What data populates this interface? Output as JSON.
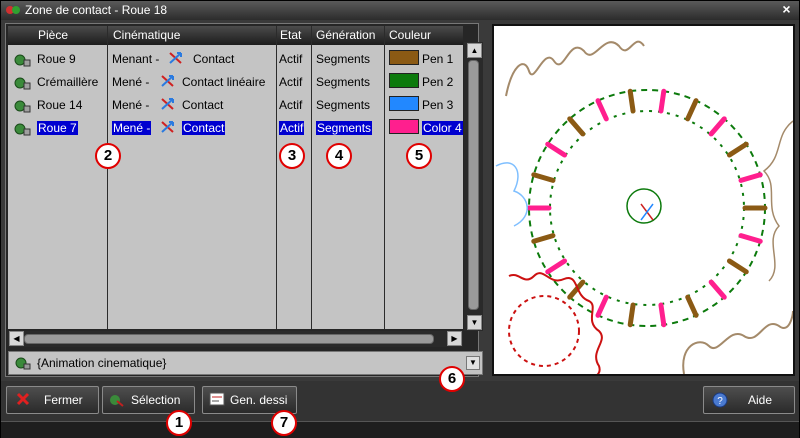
{
  "window": {
    "title": "Zone de contact - Roue 18",
    "close_glyph": "×"
  },
  "grid": {
    "headers": {
      "piece": "Pièce",
      "cinematique": "Cinématique",
      "etat": "Etat",
      "generation": "Génération",
      "couleur": "Couleur"
    },
    "rows": [
      {
        "piece": "Roue 9",
        "cin_prefix": "Menant -",
        "cin_type": "Contact",
        "etat": "Actif",
        "generation": "Segments",
        "swatch": "#8b5a14",
        "color_name": "Pen 1",
        "selected": false
      },
      {
        "piece": "Crémaillère",
        "cin_prefix": "Mené -",
        "cin_type": "Contact linéaire",
        "etat": "Actif",
        "generation": "Segments",
        "swatch": "#0c7a0c",
        "color_name": "Pen 2",
        "selected": false
      },
      {
        "piece": "Roue 14",
        "cin_prefix": "Mené -",
        "cin_type": "Contact",
        "etat": "Actif",
        "generation": "Segments",
        "swatch": "#2288ff",
        "color_name": "Pen 3",
        "selected": false
      },
      {
        "piece": "Roue 7",
        "cin_prefix": "Mené -",
        "cin_type": "Contact",
        "etat": "Actif",
        "generation": "Segments",
        "swatch": "#ff1f8e",
        "color_name": "Color 4",
        "selected": true
      }
    ]
  },
  "animation_combo": {
    "value": "{Animation cinematique}"
  },
  "buttons": {
    "fermer": "Fermer",
    "selection": "Sélection",
    "gen_dessin": "Gen. dessi",
    "aide": "Aide"
  },
  "callouts": [
    "1",
    "2",
    "3",
    "4",
    "5",
    "6",
    "7"
  ],
  "colors": {
    "pen1": "#8b5a14",
    "pen2": "#0c7a0c",
    "pen3": "#2288ff",
    "color4": "#ff1f8e",
    "selection": "#0000d0",
    "callout_border": "#e00000",
    "red_gear": "#cc1111",
    "light_blue": "#7fbfff",
    "tan": "#a48a6a"
  },
  "icons": {
    "window": "gear-contact-icon",
    "piece": "part-icon",
    "kinematic": "kinematic-arrows-icon",
    "fermer": "red-x-icon",
    "selection": "selection-icon",
    "gen": "drawing-icon",
    "aide": "help-icon"
  }
}
